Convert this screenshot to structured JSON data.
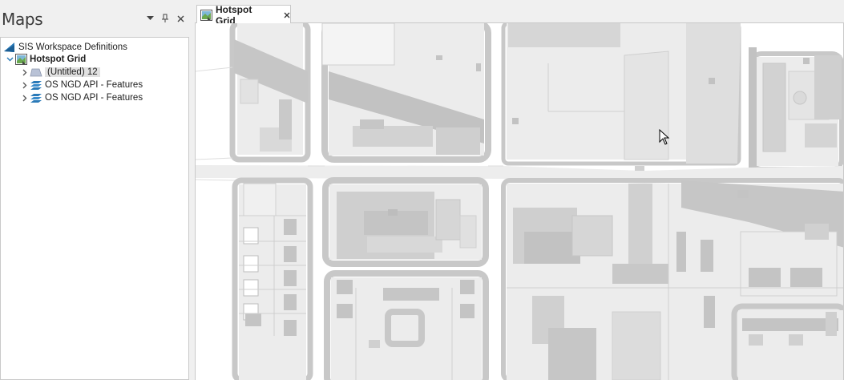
{
  "panel": {
    "title": "Maps",
    "menu_icon": "dropdown-arrow-icon",
    "pin_icon": "pin-icon",
    "close_icon": "close-icon"
  },
  "tree": {
    "workspace": {
      "label": "SIS Workspace Definitions",
      "icon": "workspace-icon"
    },
    "map": {
      "label": "Hotspot Grid",
      "icon": "map-document-icon",
      "expanded": true
    },
    "layers": [
      {
        "label": "(Untitled) 12",
        "icon": "polygon-layer-icon",
        "selected": true
      },
      {
        "label": "OS NGD API - Features",
        "icon": "layer-stack-icon"
      },
      {
        "label": "OS NGD API - Features",
        "icon": "layer-stack-icon"
      }
    ]
  },
  "document": {
    "tab_label": "Hotspot Grid",
    "tab_icon": "map-document-icon",
    "tab_close_icon": "close-icon"
  },
  "colors": {
    "road": "#c8c8c8",
    "building": "#d9d9d9",
    "building_dark": "#bdbdbd",
    "land": "#ececec",
    "accent": "#2a7ab8"
  }
}
